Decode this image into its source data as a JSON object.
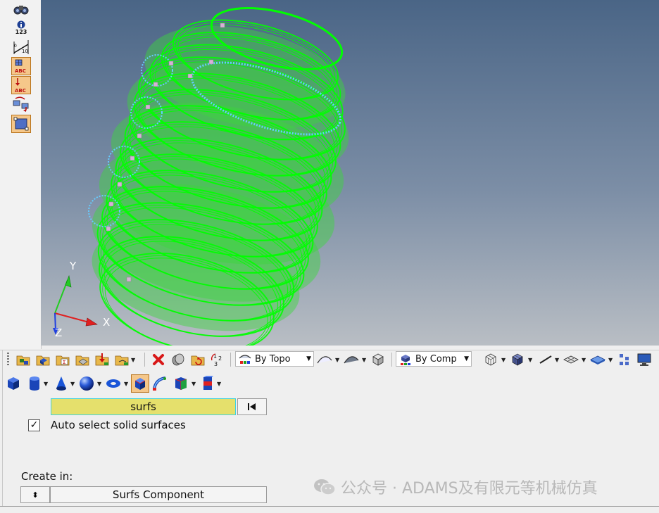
{
  "colors": {
    "viewport_top": "#4a6586",
    "viewport_bottom": "#b9bec4",
    "mesh_green": "#00ff00",
    "mesh_fill": "#3bd63b",
    "edge_blue": "#66ccff",
    "collector_bg": "#e5e06c",
    "collector_border": "#3fd2e0"
  },
  "left_toolbar": {
    "items": [
      {
        "name": "binoculars-icon"
      },
      {
        "name": "info-123-icon",
        "text": "123"
      },
      {
        "name": "ruler-measure-icon",
        "text": "10"
      },
      {
        "name": "label-abc-grid-icon",
        "text": "ABC"
      },
      {
        "name": "label-abc-pin-icon",
        "text": "ABC"
      },
      {
        "name": "reorient-icon"
      },
      {
        "name": "frame-select-icon"
      }
    ]
  },
  "viewport": {
    "axis": {
      "x": "X",
      "y": "Y",
      "z": "Z"
    }
  },
  "toolbar1": {
    "topo_combo": "By Topo",
    "comp_combo": "By Comp"
  },
  "toolbar2": {
    "icons": [
      "cube-solid-icon",
      "cylinder-icon",
      "cone-icon",
      "sphere-icon",
      "torus-icon",
      "box-selected-icon",
      "sweep-icon",
      "split-solid-icon",
      "boolean-icon"
    ]
  },
  "panel": {
    "collector_value": "surfs",
    "auto_select_label": "Auto select solid surfaces",
    "auto_select_checked": "✓",
    "create_in_label": "Create in:",
    "create_in_value": "Surfs Component",
    "spin_glyph": "⬍"
  },
  "watermark": "公众号 · ADAMS及有限元等机械仿真"
}
